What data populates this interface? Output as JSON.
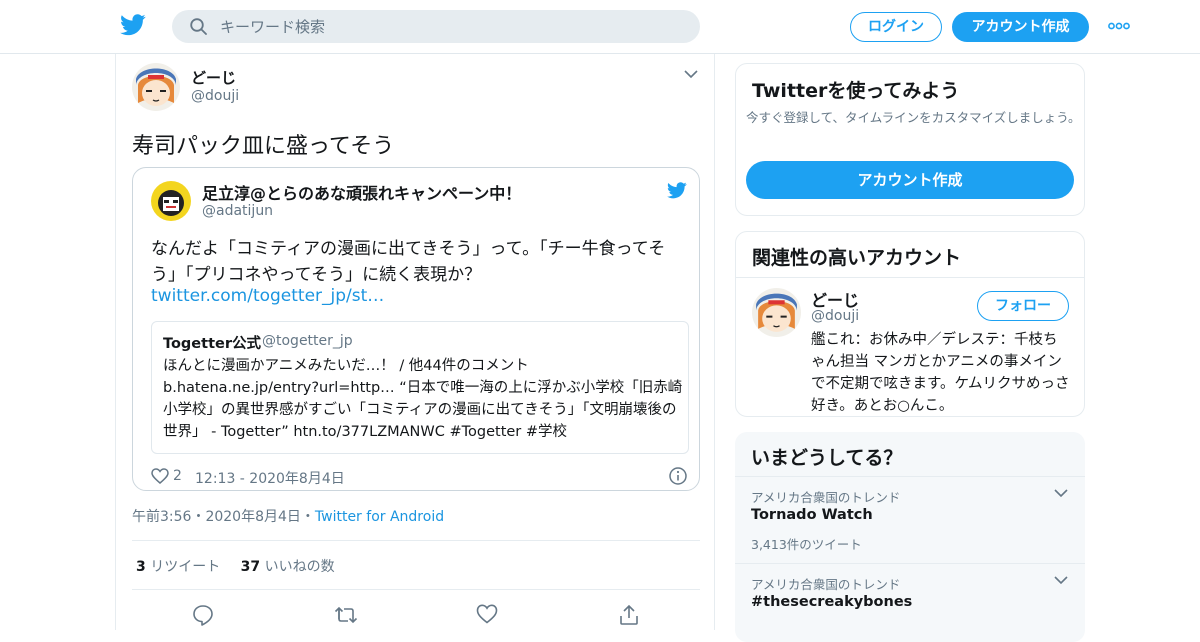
{
  "header": {
    "search_placeholder": "キーワード検索",
    "login_label": "ログイン",
    "signup_label": "アカウント作成"
  },
  "tweet": {
    "author_name": "どーじ",
    "author_handle": "@douji",
    "text": "寿司パック皿に盛ってそう",
    "timestamp": "午前3:56・2020年8月4日・",
    "client": "Twitter for Android",
    "retweet_count": "3",
    "retweet_label": "リツイート",
    "like_count": "37",
    "like_label": "いいねの数",
    "quoted": {
      "author_name": "足立淳@とらのあな頑張れキャンペーン中！",
      "author_handle": "@adatijun",
      "text": "なんだよ「コミティアの漫画に出てきそう」って。「チー牛食ってそう」「プリコネやってそう」に続く表現か？",
      "link": "twitter.com/togetter_jp/st…",
      "inner": {
        "author_name": "Togetter公式",
        "author_handle": "@togetter_jp",
        "text": "ほんとに漫画かアニメみたいだ…！ / 他44件のコメント b.hatena.ne.jp/entry?url=http… “日本で唯一海の上に浮かぶ小学校「旧赤崎小学校」の異世界感がすごい「コミティアの漫画に出てきそう」「文明崩壊後の世界」 - Togetter” htn.to/377LZMANWC #Togetter #学校"
      },
      "likes": "2",
      "date": "12:13 - 2020年8月4日"
    }
  },
  "sidebar": {
    "signup_card": {
      "title": "Twitterを使ってみよう",
      "description": "今すぐ登録して、タイムラインをカスタマイズしましょう。",
      "button_label": "アカウント作成"
    },
    "related": {
      "title": "関連性の高いアカウント",
      "name": "どーじ",
      "handle": "@douji",
      "follow_label": "フォロー",
      "bio": "艦これ：お休み中／デレステ：千枝ちゃん担当 マンガとかアニメの事メインで不定期で呟きます。ケムリクサめっさ好き。あとお○んこ。"
    },
    "trends": {
      "title": "いまどうしてる？",
      "items": [
        {
          "context": "アメリカ合衆国のトレンド",
          "name": "Tornado Watch",
          "count": "3,413件のツイート"
        },
        {
          "context": "アメリカ合衆国のトレンド",
          "name": "#thesecreakybones",
          "count": ""
        }
      ]
    }
  },
  "colors": {
    "accent": "#1da1f2",
    "link": "#1b95e0",
    "muted": "#657786"
  }
}
